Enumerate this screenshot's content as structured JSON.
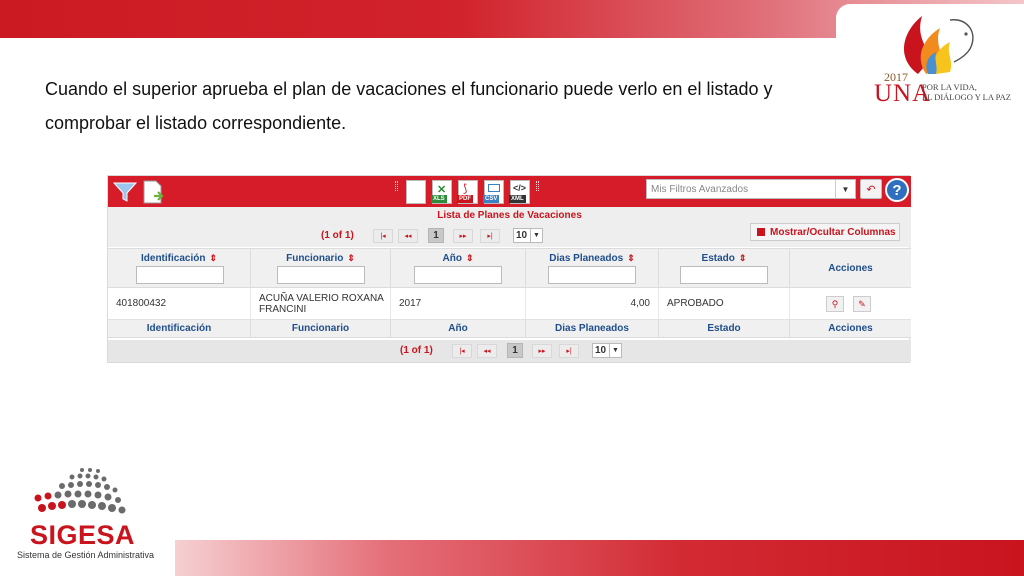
{
  "slide": {
    "text": "Cuando el superior aprueba el plan de vacaciones el funcionario puede verlo en el listado y comprobar el listado correspondiente."
  },
  "logos": {
    "una_year": "2017",
    "una_word": "UNA",
    "una_tag_line1": "POR LA VIDA,",
    "una_tag_line2": "EL DIÁLOGO Y LA PAZ",
    "sigesa_word": "SIGESA",
    "sigesa_sub": "Sistema de Gestión Administrativa"
  },
  "toolbar": {
    "filter_placeholder": "Mis Filtros Avanzados",
    "export_tags": [
      "XLS",
      "PDF",
      "CSV",
      "XML"
    ],
    "help_label": "?"
  },
  "table": {
    "caption": "Lista de Planes de Vacaciones",
    "toggle_columns_label": "Mostrar/Ocultar Columnas",
    "pager": {
      "status": "(1 of 1)",
      "current_page": "1",
      "rows_per_page": "10"
    },
    "columns": [
      "Identificación",
      "Funcionario",
      "Año",
      "Dias Planeados",
      "Estado",
      "Acciones"
    ],
    "rows": [
      {
        "identificacion": "401800432",
        "funcionario": "ACUÑA VALERIO ROXANA FRANCINI",
        "anio": "2017",
        "dias": "4,00",
        "estado": "APROBADO"
      }
    ]
  },
  "colors": {
    "brand_red": "#d51c28",
    "header_text": "#1f4e8c"
  }
}
